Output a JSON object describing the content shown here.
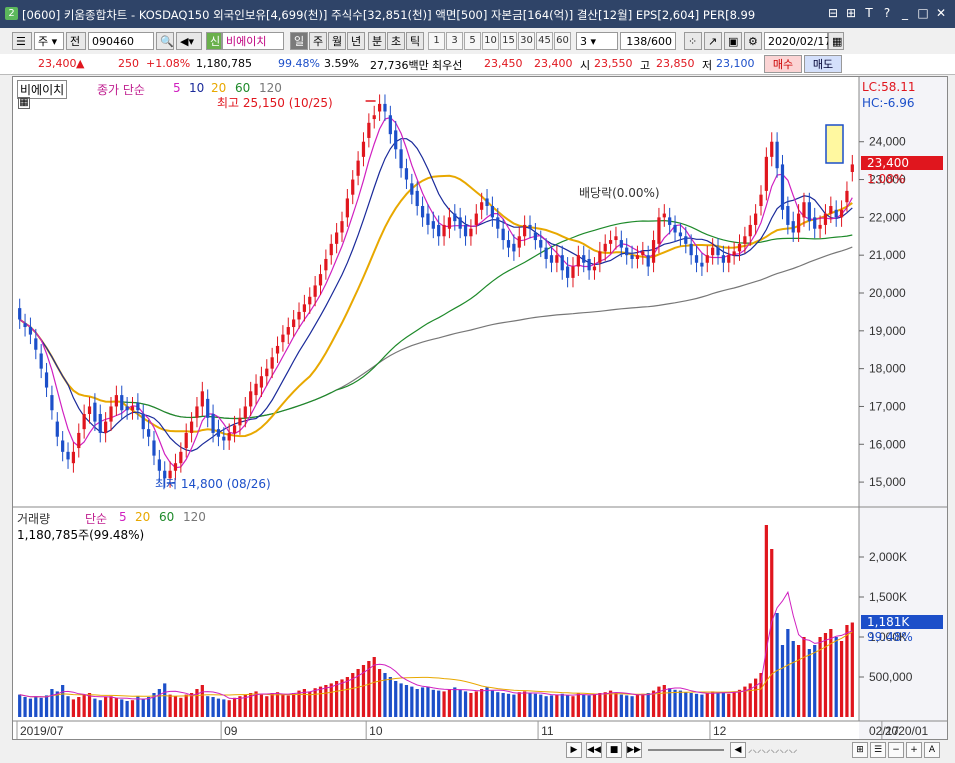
{
  "window": {
    "screen_no": "2",
    "title": "[0600] 키움종합차트 - KOSDAQ150 외국인보유[4,699(천)] 주식수[32,851(천)] 액면[500] 자본금[164(억)] 결산[12월] EPS[2,604] PER[8.99",
    "buttons": [
      "⊟",
      "⊞",
      "T",
      "?",
      "_",
      "□",
      "✕"
    ]
  },
  "toolbar": {
    "type_label": "주",
    "prev_label": "전",
    "code": "090460",
    "new_badge": "신",
    "stock_name": "비에이치",
    "periods": [
      "일",
      "주",
      "월",
      "년",
      "분",
      "초",
      "틱"
    ],
    "numbers": [
      "1",
      "3",
      "5",
      "10",
      "15",
      "30",
      "45",
      "60"
    ],
    "count_value": "3",
    "page": "138/600",
    "date": "2020/02/17"
  },
  "quote": {
    "price": "23,400",
    "arrow": "▲",
    "change": "250",
    "change_pct": "+1.08%",
    "volume": "1,180,785",
    "vol_ratio": "99.48%",
    "turnover": "3.59%",
    "amount": "27,736백만",
    "best_ask_label": "최우선",
    "ask": "23,450",
    "bid": "23,400",
    "open_label": "시",
    "open": "23,550",
    "high_label": "고",
    "high": "23,850",
    "low_label": "저",
    "low": "23,100",
    "buy_label": "매수",
    "sell_label": "매도"
  },
  "legend": {
    "name": "비에이치",
    "ma_label": "종가 단순",
    "ma_periods": [
      "5",
      "10",
      "20",
      "60",
      "120"
    ],
    "vol_label": "거래량",
    "vol_ma_label": "단순",
    "volume_value": "1,180,785주(99.48%)",
    "lc": "LC:58.11",
    "hc": "HC:-6.96",
    "current_price": "23,400",
    "current_pct": "1.08%",
    "current_vol": "1,181K",
    "current_vol_pct": "99.48%",
    "high_note": "최고 25,150 (10/25)",
    "low_note": "최저 14,800 (08/26)",
    "dividend_note": "배당락(0.00%)"
  },
  "colors": {
    "up": "#e0161e",
    "down": "#1c4fc9",
    "ma5": "#d020c0",
    "ma10": "#1a2a9a",
    "ma20": "#e8a800",
    "ma60": "#1e8a2a",
    "ma120": "#777777"
  },
  "chart_data": {
    "type": "candlestick",
    "price_axis": {
      "min": 14500,
      "max": 25500,
      "ticks": [
        "15,000",
        "16,000",
        "17,000",
        "18,000",
        "19,000",
        "20,000",
        "21,000",
        "22,000",
        "23,000",
        "24,000"
      ]
    },
    "volume_axis": {
      "min": 0,
      "max": 2500000,
      "ticks": [
        "500,000",
        "1,000K",
        "1,500K",
        "2,000K"
      ]
    },
    "x_labels": [
      {
        "i": 0,
        "label": "2019/07"
      },
      {
        "i": 38,
        "label": "09"
      },
      {
        "i": 65,
        "label": "10"
      },
      {
        "i": 97,
        "label": "11"
      },
      {
        "i": 129,
        "label": "12"
      },
      {
        "i": 161,
        "label": "2020/01"
      },
      {
        "i": 186,
        "label": "02"
      }
    ],
    "last_date_label": "02/17",
    "closes": [
      19300,
      19100,
      18900,
      18500,
      18000,
      17500,
      16900,
      16200,
      15800,
      15600,
      15800,
      16300,
      16800,
      17000,
      16600,
      16300,
      16600,
      17000,
      17300,
      16900,
      16900,
      17000,
      16900,
      16400,
      16200,
      15700,
      15300,
      15100,
      15300,
      15500,
      15800,
      16300,
      16600,
      17000,
      17400,
      16700,
      16300,
      16200,
      16100,
      16300,
      16500,
      16700,
      17000,
      17400,
      17600,
      17800,
      18000,
      18300,
      18600,
      18900,
      19100,
      19300,
      19500,
      19700,
      19900,
      20200,
      20500,
      20900,
      21300,
      21600,
      21900,
      22500,
      23000,
      23500,
      24000,
      24500,
      24700,
      25000,
      24800,
      24200,
      23800,
      23300,
      23000,
      22600,
      22300,
      22000,
      21800,
      21700,
      21500,
      21800,
      22000,
      21900,
      21700,
      21500,
      21700,
      22100,
      22400,
      22300,
      22000,
      21700,
      21400,
      21200,
      21100,
      21500,
      21800,
      21700,
      21400,
      21200,
      20900,
      20800,
      21000,
      20600,
      20400,
      20700,
      21000,
      20800,
      20600,
      20700,
      21100,
      21300,
      21400,
      21500,
      21200,
      21000,
      20900,
      21000,
      21100,
      20700,
      21400,
      22000,
      22100,
      21800,
      21600,
      21500,
      21300,
      21000,
      20800,
      20700,
      21000,
      21200,
      21000,
      20800,
      21000,
      21100,
      21300,
      21500,
      21800,
      22100,
      22600,
      23600,
      24000,
      23300,
      22200,
      21800,
      21600,
      22100,
      22400,
      21900,
      21700,
      21800,
      22100,
      22300,
      22000,
      22200,
      22700,
      23400
    ],
    "opens": [
      19600,
      19200,
      19100,
      18800,
      18400,
      17900,
      17300,
      16600,
      16100,
      15800,
      15500,
      15900,
      16400,
      16800,
      17100,
      16800,
      16300,
      16600,
      17000,
      17300,
      17000,
      16900,
      17100,
      16800,
      16400,
      16100,
      15600,
      15300,
      15100,
      15300,
      15500,
      15900,
      16300,
      16700,
      17000,
      17200,
      16800,
      16400,
      16200,
      16100,
      16300,
      16500,
      16700,
      17000,
      17300,
      17500,
      17800,
      18000,
      18400,
      18700,
      18900,
      19100,
      19300,
      19500,
      19700,
      19900,
      20200,
      20600,
      21000,
      21300,
      21600,
      22000,
      22600,
      23100,
      23600,
      24100,
      24600,
      24800,
      25000,
      24700,
      24300,
      23800,
      23300,
      22900,
      22700,
      22300,
      22100,
      21900,
      21800,
      21500,
      21700,
      22100,
      22000,
      21800,
      21500,
      21800,
      22200,
      22500,
      22300,
      22000,
      21700,
      21400,
      21300,
      21200,
      21500,
      21800,
      21600,
      21400,
      21200,
      21000,
      20800,
      21000,
      20700,
      20400,
      20700,
      21000,
      20900,
      20600,
      20800,
      21100,
      21300,
      21400,
      21400,
      21200,
      21000,
      20900,
      21000,
      21000,
      20800,
      21300,
      22000,
      22000,
      21800,
      21600,
      21500,
      21300,
      21000,
      20800,
      20800,
      21000,
      21200,
      21000,
      20800,
      21000,
      21100,
      21300,
      21500,
      21800,
      22300,
      22700,
      23600,
      24000,
      23400,
      22300,
      21900,
      21600,
      22000,
      22400,
      22000,
      21700,
      21800,
      22100,
      22200,
      22000,
      22400,
      23200
    ],
    "volumes": [
      280000,
      250000,
      230000,
      260000,
      240000,
      270000,
      350000,
      320000,
      400000,
      260000,
      220000,
      250000,
      280000,
      300000,
      230000,
      210000,
      250000,
      260000,
      240000,
      220000,
      200000,
      210000,
      260000,
      230000,
      250000,
      300000,
      350000,
      420000,
      280000,
      260000,
      240000,
      280000,
      300000,
      350000,
      400000,
      260000,
      250000,
      230000,
      220000,
      210000,
      240000,
      260000,
      280000,
      300000,
      320000,
      280000,
      260000,
      300000,
      310000,
      290000,
      270000,
      300000,
      330000,
      350000,
      320000,
      360000,
      380000,
      400000,
      420000,
      450000,
      470000,
      500000,
      550000,
      600000,
      650000,
      700000,
      750000,
      600000,
      550000,
      500000,
      450000,
      420000,
      400000,
      380000,
      350000,
      370000,
      380000,
      340000,
      330000,
      320000,
      350000,
      370000,
      340000,
      320000,
      300000,
      320000,
      350000,
      370000,
      330000,
      310000,
      300000,
      290000,
      280000,
      310000,
      320000,
      300000,
      290000,
      280000,
      260000,
      270000,
      280000,
      290000,
      270000,
      260000,
      300000,
      280000,
      270000,
      290000,
      300000,
      310000,
      330000,
      300000,
      280000,
      270000,
      260000,
      280000,
      290000,
      300000,
      330000,
      380000,
      400000,
      360000,
      340000,
      330000,
      310000,
      300000,
      290000,
      280000,
      300000,
      320000,
      310000,
      300000,
      290000,
      320000,
      340000,
      380000,
      420000,
      480000,
      550000,
      2400000,
      2100000,
      1300000,
      900000,
      1100000,
      950000,
      900000,
      1000000,
      850000,
      900000,
      1000000,
      1050000,
      1100000,
      1000000,
      950000,
      1150000,
      1181000
    ]
  }
}
